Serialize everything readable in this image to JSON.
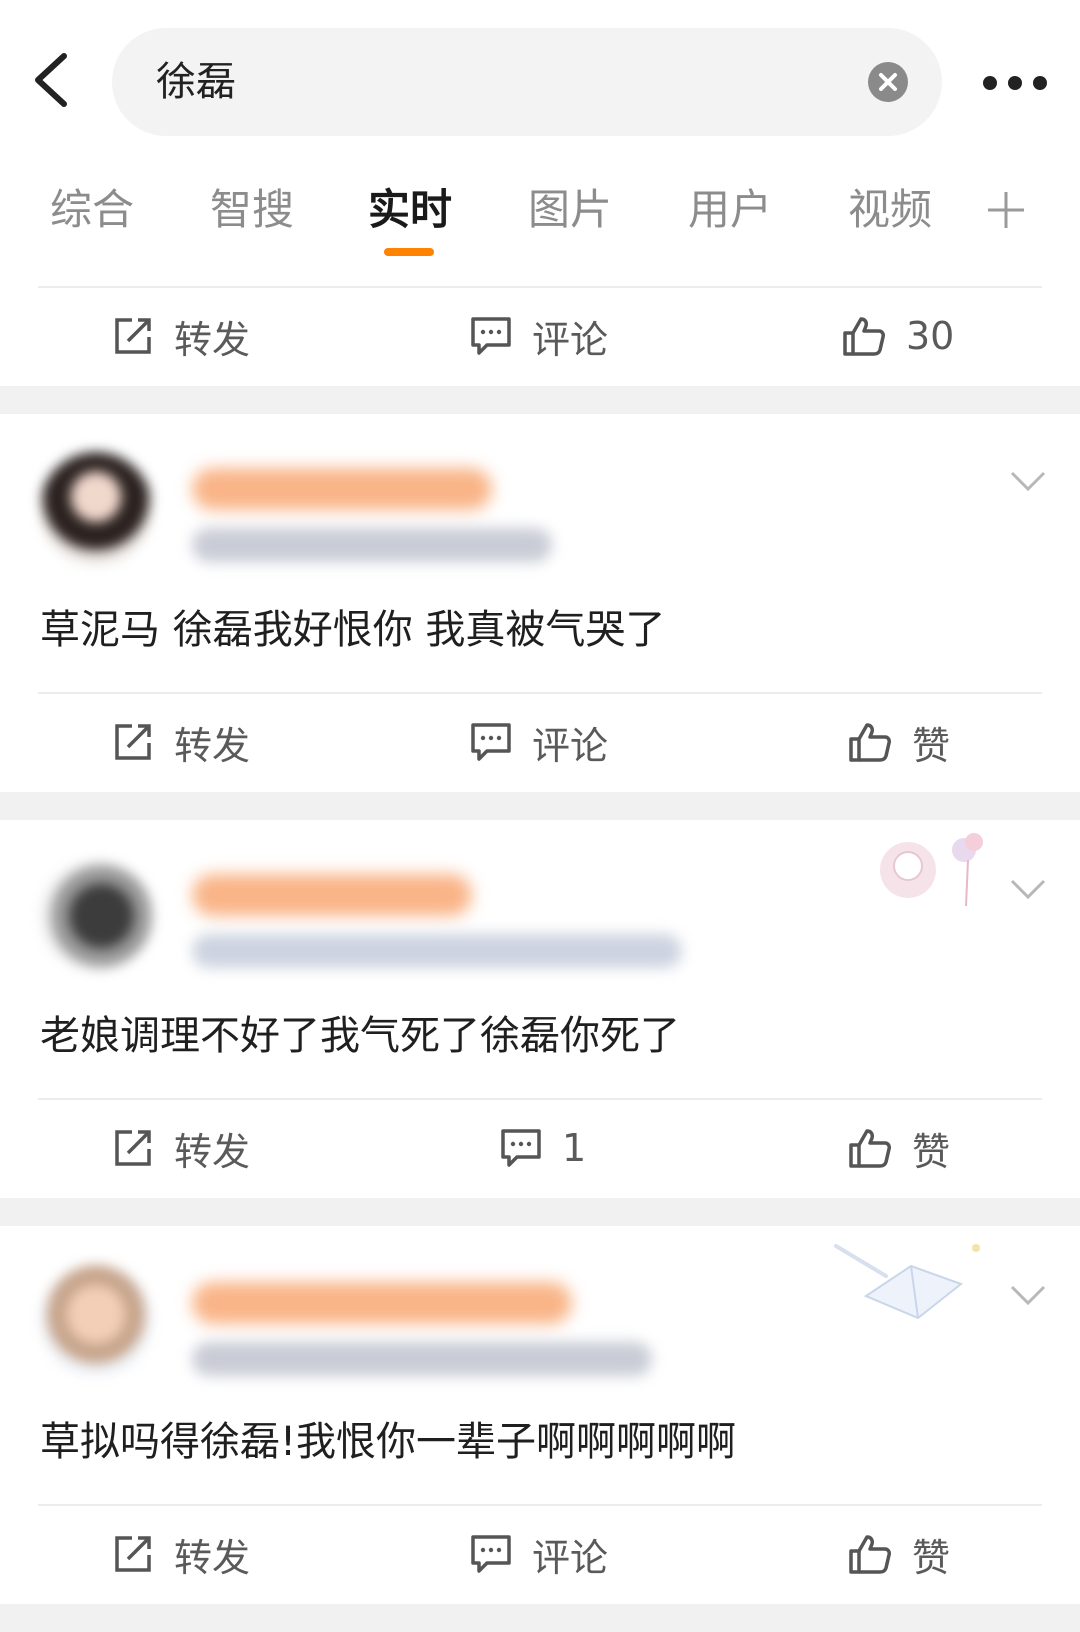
{
  "search": {
    "query": "徐磊"
  },
  "tabs": [
    {
      "label": "综合"
    },
    {
      "label": "智搜"
    },
    {
      "label": "实时"
    },
    {
      "label": "图片"
    },
    {
      "label": "用户"
    },
    {
      "label": "视频"
    }
  ],
  "active_tab": "实时",
  "colors": {
    "accent": "#ff8200",
    "divider": "#f1f1f1"
  },
  "top_action_bar": {
    "repost": "转发",
    "comment": "评论",
    "like": "30"
  },
  "posts": [
    {
      "text": "草泥马 徐磊我好恨你 我真被气哭了",
      "actions": {
        "repost": "转发",
        "comment": "评论",
        "like": "赞"
      }
    },
    {
      "text": "老娘调理不好了我气死了徐磊你死了",
      "actions": {
        "repost": "转发",
        "comment": "1",
        "like": "赞"
      }
    },
    {
      "text": "草拟吗得徐磊!我恨你一辈子啊啊啊啊啊",
      "actions": {
        "repost": "转发",
        "comment": "评论",
        "like": "赞"
      }
    }
  ],
  "icons": [
    "back-arrow-icon",
    "clear-icon",
    "more-icon",
    "plus-icon",
    "repost-icon",
    "comment-icon",
    "like-icon",
    "chevron-down-icon"
  ]
}
